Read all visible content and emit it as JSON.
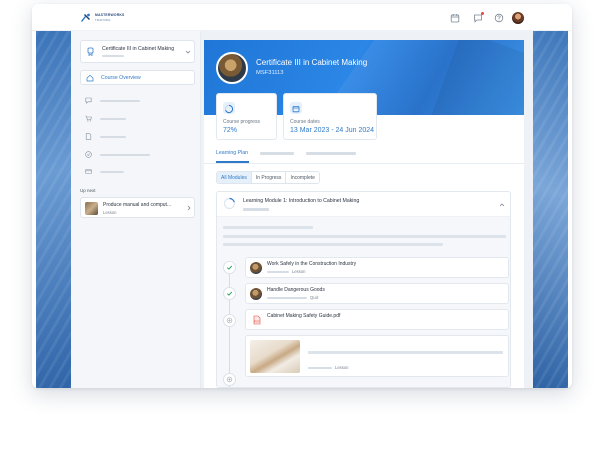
{
  "header": {
    "logo_line1": "MASTERWORKS",
    "logo_line2": "TRAINING",
    "icons": [
      "calendar-icon",
      "chat-icon",
      "help-icon"
    ]
  },
  "sidebar": {
    "course_select_title": "Certificate III in Cabinet Making",
    "nav_active_label": "Course Overview",
    "nav_icons": [
      "home-icon",
      "chat-icon",
      "cart-icon",
      "document-icon",
      "check-circle-icon",
      "card-icon"
    ],
    "up_next_label": "Up next",
    "up_next_title": "Produce manual and comput...",
    "up_next_sub": "Lesson"
  },
  "hero": {
    "title": "Certificate III in Cabinet Making",
    "code": "MSF31113"
  },
  "stats": {
    "progress_label": "Course progress",
    "progress_value": "72%",
    "dates_label": "Course dates",
    "dates_value": "13 Mar 2023 - 24 Jun 2024"
  },
  "tabs": {
    "active": "Learning Plan"
  },
  "filters": [
    "All Modules",
    "In Progress",
    "Incomplete"
  ],
  "module": {
    "title": "Learning Module 1: Introduction to Cabinet Making",
    "lessons": [
      {
        "title": "Work Safely in the Construction Industry",
        "type": "Lesson",
        "status": "complete"
      },
      {
        "title": "Handle Dangerous Goods",
        "type": "Quiz",
        "status": "complete"
      },
      {
        "title": "Cabinet Making Safety Guide.pdf",
        "type": "",
        "status": "pending"
      }
    ],
    "last_item_type": "Lesson"
  },
  "colors": {
    "accent": "#2f7ac8",
    "hero_blue": "#1f76d6",
    "check_green": "#2fa86b"
  }
}
